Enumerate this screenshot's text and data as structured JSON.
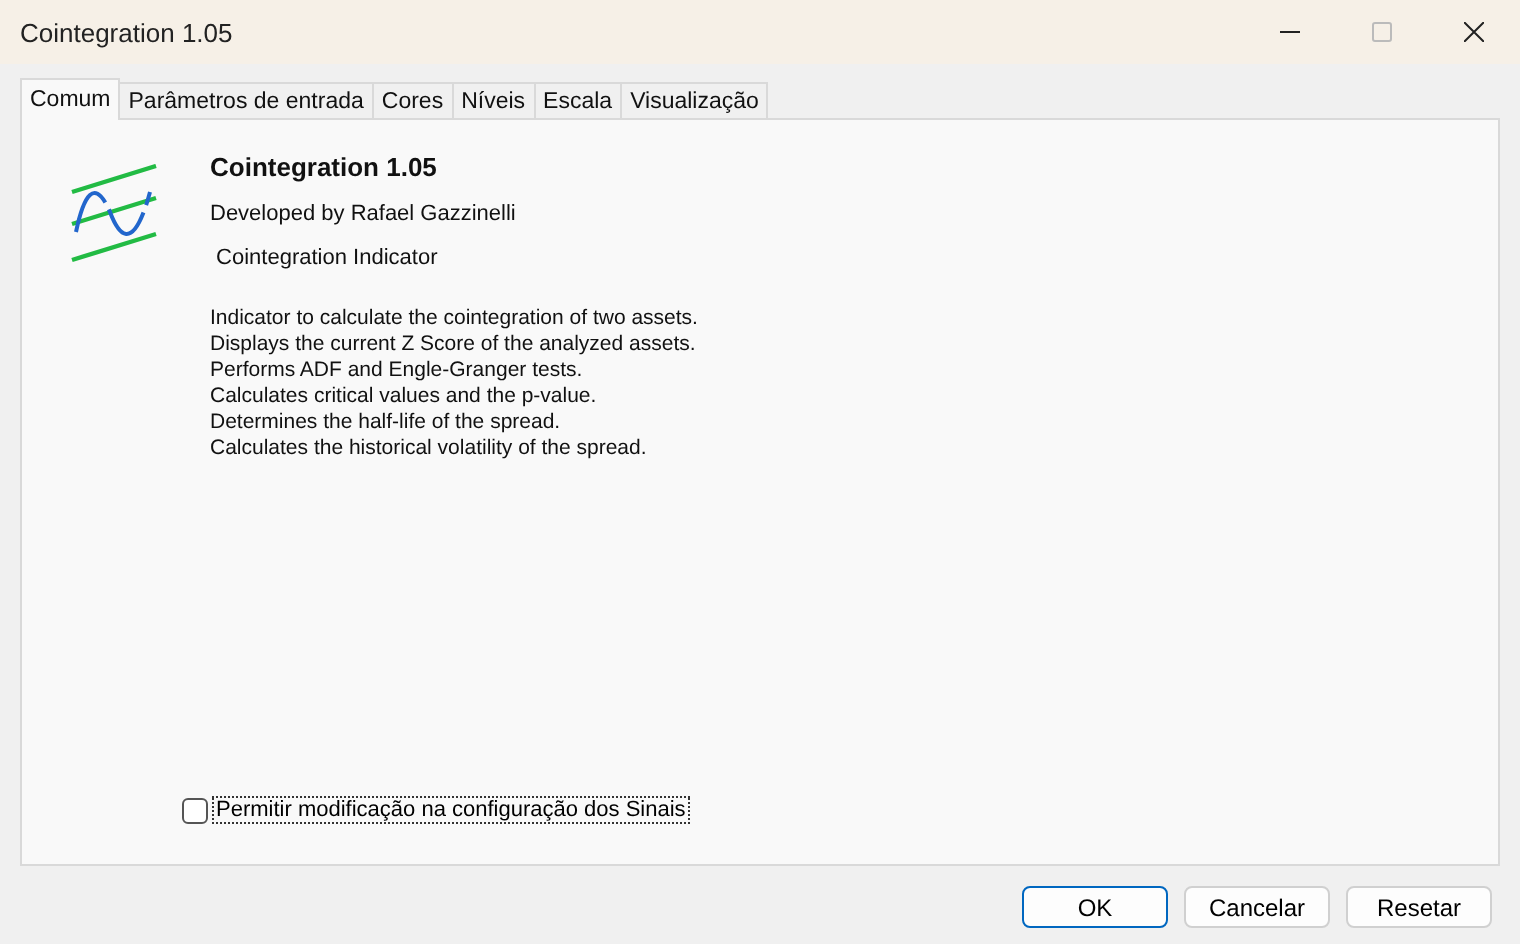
{
  "window": {
    "title": "Cointegration 1.05"
  },
  "tabs": [
    {
      "label": "Comum",
      "selected": true
    },
    {
      "label": "Parâmetros de entrada",
      "selected": false
    },
    {
      "label": "Cores",
      "selected": false
    },
    {
      "label": "Níveis",
      "selected": false
    },
    {
      "label": "Escala",
      "selected": false
    },
    {
      "label": "Visualização",
      "selected": false
    }
  ],
  "info": {
    "name": "Cointegration 1.05",
    "author": "Developed by Rafael Gazzinelli",
    "subtitle": " Cointegration Indicator",
    "description": [
      "Indicator to calculate the cointegration of two assets.",
      "Displays the current Z Score of the analyzed assets.",
      "Performs ADF and Engle-Granger tests.",
      "Calculates critical values and the p-value.",
      "Determines the half-life of the spread.",
      "Calculates the historical volatility of the spread."
    ]
  },
  "checkbox": {
    "label": "Permitir modificação na configuração dos Sinais",
    "checked": false
  },
  "buttons": [
    {
      "label": "OK",
      "selected": true
    },
    {
      "label": "Cancelar",
      "selected": false
    },
    {
      "label": "Resetar",
      "selected": false
    }
  ]
}
